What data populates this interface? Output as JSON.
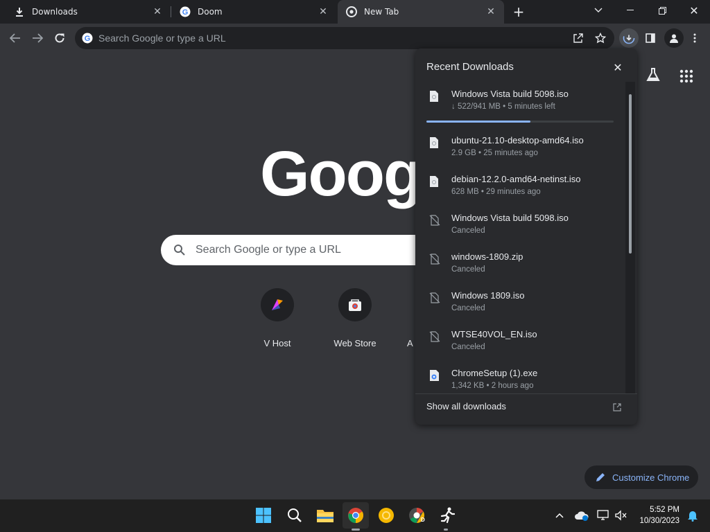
{
  "tabs": [
    {
      "title": "Downloads",
      "icon": "download-icon",
      "active": false
    },
    {
      "title": "Doom",
      "icon": "google-g-icon",
      "active": false
    },
    {
      "title": "New Tab",
      "icon": "chrome-icon",
      "active": true
    }
  ],
  "omnibox": {
    "placeholder": "Search Google or type a URL"
  },
  "ntp": {
    "logo_text": "Googl",
    "search_placeholder": "Search Google or type a URL",
    "shortcuts": [
      {
        "label": "V Host",
        "icon": "vhost-icon"
      },
      {
        "label": "Web Store",
        "icon": "web-store-icon"
      },
      {
        "label": "Ac",
        "icon": "add-icon"
      }
    ],
    "customize_label": "Customize Chrome"
  },
  "downloads": {
    "title": "Recent Downloads",
    "items": [
      {
        "name": "Windows Vista build 5098.iso",
        "status": "↓ 522/941 MB • 5 minutes left",
        "icon": "file-icon",
        "progress": 0.555
      },
      {
        "name": "ubuntu-21.10-desktop-amd64.iso",
        "status": "2.9 GB • 25 minutes ago",
        "icon": "file-icon"
      },
      {
        "name": "debian-12.2.0-amd64-netinst.iso",
        "status": "628 MB • 29 minutes ago",
        "icon": "file-icon"
      },
      {
        "name": "Windows Vista build 5098.iso",
        "status": "Canceled",
        "icon": "file-off-icon"
      },
      {
        "name": "windows-1809.zip",
        "status": "Canceled",
        "icon": "file-off-icon"
      },
      {
        "name": "Windows 1809.iso",
        "status": "Canceled",
        "icon": "file-off-icon"
      },
      {
        "name": "WTSE40VOL_EN.iso",
        "status": "Canceled",
        "icon": "file-off-icon"
      },
      {
        "name": "ChromeSetup (1).exe",
        "status": "1,342 KB • 2 hours ago",
        "icon": "installer-icon"
      }
    ],
    "show_all_label": "Show all downloads"
  },
  "taskbar": {
    "time": "5:52 PM",
    "date": "10/30/2023"
  },
  "colors": {
    "accent": "#8ab4f8",
    "tabstrip_bg": "#202124",
    "page_bg": "#35363a",
    "panel_bg": "#292a2d"
  }
}
